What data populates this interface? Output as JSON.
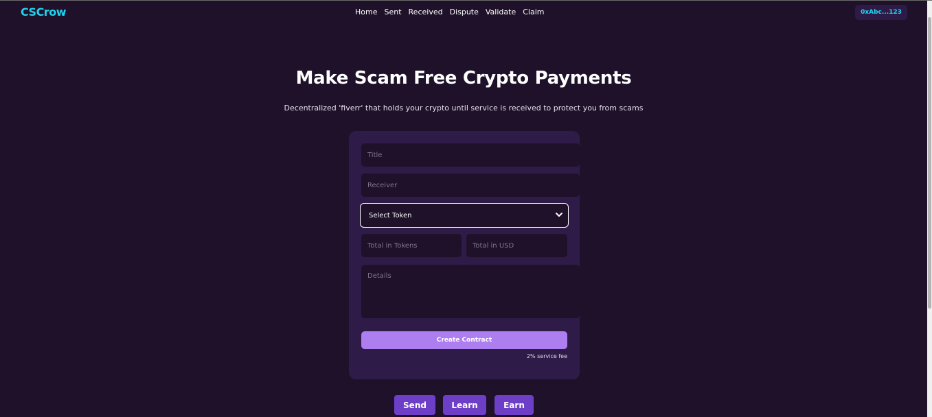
{
  "header": {
    "logo": "CSCrow",
    "nav": [
      "Home",
      "Sent",
      "Received",
      "Dispute",
      "Validate",
      "Claim"
    ],
    "wallet": "0xAbc...123"
  },
  "hero": {
    "title": "Make Scam Free Crypto Payments",
    "subtitle": "Decentralized 'fiverr' that holds your crypto until service is received to protect you from scams"
  },
  "form": {
    "title_placeholder": "Title",
    "receiver_placeholder": "Receiver",
    "token_select": "Select Token",
    "tokens_placeholder": "Total in Tokens",
    "usd_placeholder": "Total in USD",
    "details_placeholder": "Details",
    "create_button": "Create Contract",
    "fee_note": "2% service fee"
  },
  "actions": {
    "send": "Send",
    "learn": "Learn",
    "earn": "Earn"
  },
  "colors": {
    "background": "#1e1129",
    "card": "#2f1b47",
    "accent": "#22d3ee",
    "primary_button": "#ac7ef0",
    "secondary_button": "#6d3fc7"
  }
}
